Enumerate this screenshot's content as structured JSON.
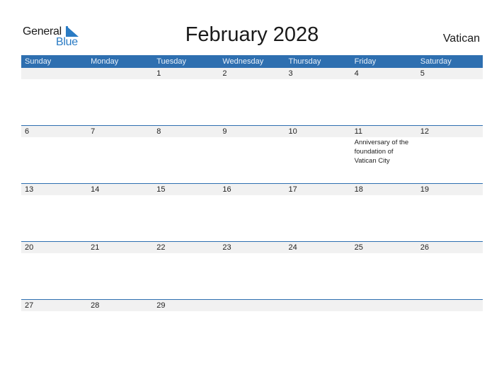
{
  "logo": {
    "word1": "General",
    "word2": "Blue"
  },
  "title": "February 2028",
  "country": "Vatican",
  "weekdays": [
    "Sunday",
    "Monday",
    "Tuesday",
    "Wednesday",
    "Thursday",
    "Friday",
    "Saturday"
  ],
  "weeks": [
    {
      "days": [
        "",
        "",
        "1",
        "2",
        "3",
        "4",
        "5"
      ],
      "events": [
        "",
        "",
        "",
        "",
        "",
        "",
        ""
      ]
    },
    {
      "days": [
        "6",
        "7",
        "8",
        "9",
        "10",
        "11",
        "12"
      ],
      "events": [
        "",
        "",
        "",
        "",
        "",
        "Anniversary of the foundation of Vatican City",
        ""
      ]
    },
    {
      "days": [
        "13",
        "14",
        "15",
        "16",
        "17",
        "18",
        "19"
      ],
      "events": [
        "",
        "",
        "",
        "",
        "",
        "",
        ""
      ]
    },
    {
      "days": [
        "20",
        "21",
        "22",
        "23",
        "24",
        "25",
        "26"
      ],
      "events": [
        "",
        "",
        "",
        "",
        "",
        "",
        ""
      ]
    },
    {
      "days": [
        "27",
        "28",
        "29",
        "",
        "",
        "",
        ""
      ],
      "events": [
        "",
        "",
        "",
        "",
        "",
        "",
        ""
      ]
    }
  ],
  "colors": {
    "header_bg": "#2e6fb0",
    "day_bar_bg": "#f1f1f1",
    "brand_blue": "#2a7bc4"
  }
}
